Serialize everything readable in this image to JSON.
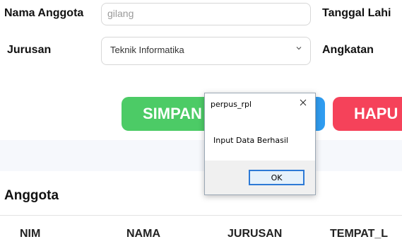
{
  "form": {
    "nama_label": "Nama Anggota",
    "nama_value": "gilang",
    "tanggal_label": "Tanggal Lahi",
    "jurusan_label": "Jurusan",
    "jurusan_value": "Teknik Informatika",
    "angkatan_label": "Angkatan"
  },
  "buttons": {
    "simpan_label": "SIMPAN",
    "hapus_label": "HAPU",
    "simpan_color": "#4ccb66",
    "hapus_color": "#f5425a",
    "blue_color": "#2f9cf0"
  },
  "section": {
    "title": "Anggota"
  },
  "table": {
    "headers": [
      "NIM",
      "NAMA",
      "JURUSAN",
      "TEMPAT_L"
    ]
  },
  "dialog": {
    "title": "perpus_rpl",
    "message": "Input Data Berhasil",
    "ok_label": "OK"
  }
}
